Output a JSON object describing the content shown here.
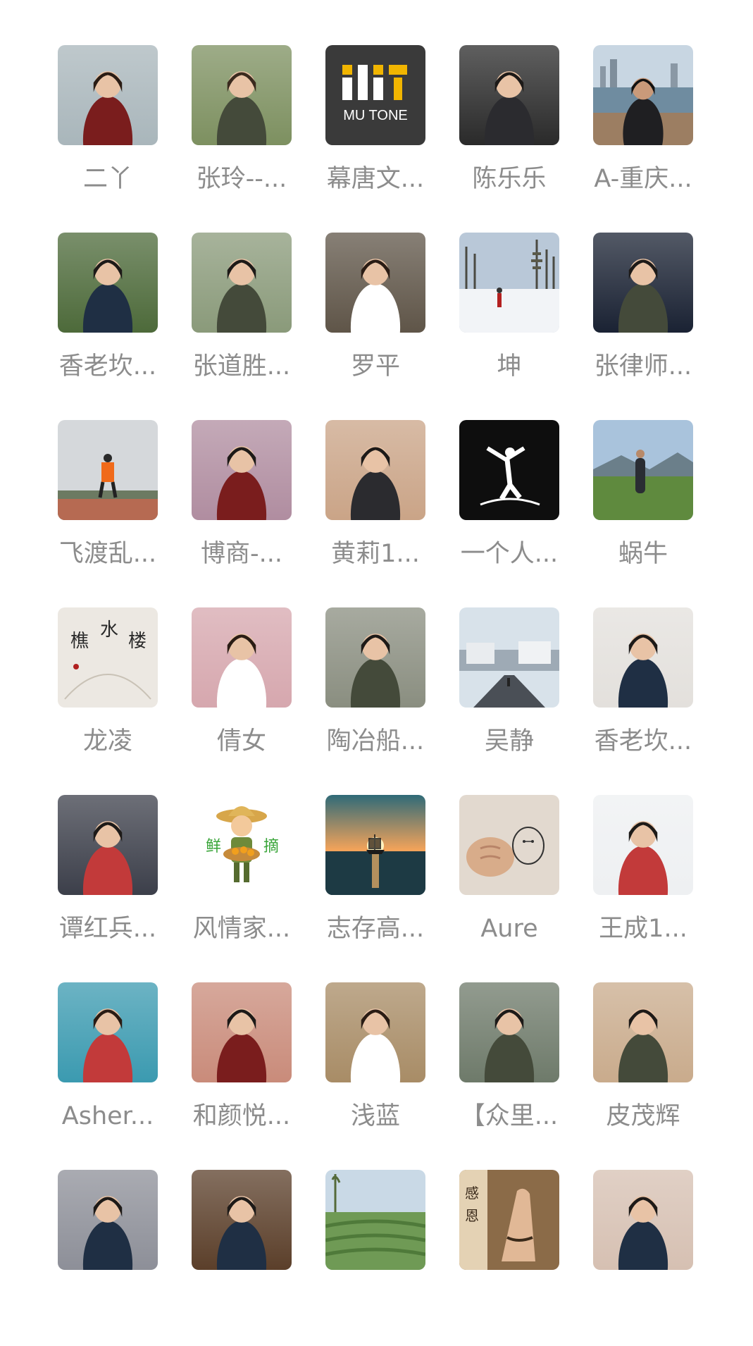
{
  "members": [
    {
      "name": "二丫",
      "avatar": "photo-two-women-seaside",
      "bg": "#a9b6bb"
    },
    {
      "name": "张玲--...",
      "avatar": "photo-woman-garden",
      "bg": "#7d9060"
    },
    {
      "name": "幕唐文...",
      "avatar": "logo-mu-tone",
      "bg": "#3a3a3a",
      "logo_text": "MU TONE"
    },
    {
      "name": "陈乐乐",
      "avatar": "photo-mother-and-child-portrait",
      "bg": "#2a2a2a"
    },
    {
      "name": "A-重庆...",
      "avatar": "photo-man-harbor-city",
      "bg": "#8ea4b3"
    },
    {
      "name": "香老坎...",
      "avatar": "photo-woman-cap-flowers",
      "bg": "#4d6a3a"
    },
    {
      "name": "张道胜...",
      "avatar": "photo-man-glasses-mountains",
      "bg": "#8a9a7a"
    },
    {
      "name": "罗平",
      "avatar": "photo-woman-and-child-bench",
      "bg": "#5f5548"
    },
    {
      "name": "坤",
      "avatar": "photo-snowy-path-trees",
      "bg": "#b9c8d8"
    },
    {
      "name": "张律师...",
      "avatar": "photo-man-suit-dark",
      "bg": "#1a2233"
    },
    {
      "name": "飞渡乱...",
      "avatar": "photo-runner-track",
      "bg": "#c7cacd"
    },
    {
      "name": "博商-...",
      "avatar": "photo-woman-selfie",
      "bg": "#b08da0"
    },
    {
      "name": "黄莉1...",
      "avatar": "photo-woman-playground",
      "bg": "#caa487"
    },
    {
      "name": "一个人...",
      "avatar": "logo-dancer-silhouette",
      "bg": "#0e0e0e"
    },
    {
      "name": "蜗牛",
      "avatar": "photo-man-grassland",
      "bg": "#5c7a52"
    },
    {
      "name": "龙凌",
      "avatar": "photo-calligraphy-fan",
      "bg": "#ece8e2"
    },
    {
      "name": "倩女",
      "avatar": "photo-woman-blossoms",
      "bg": "#d6a7ae"
    },
    {
      "name": "陶冶船...",
      "avatar": "photo-photographer-tripod",
      "bg": "#8a8e80"
    },
    {
      "name": "吴静",
      "avatar": "photo-boardwalk-winter",
      "bg": "#bfc9d2"
    },
    {
      "name": "香老坎...",
      "avatar": "photo-smiling-toddler",
      "bg": "#e3e0dc"
    },
    {
      "name": "谭红兵...",
      "avatar": "photo-boy-drinking",
      "bg": "#3c3f4a"
    },
    {
      "name": "风情家...",
      "avatar": "logo-farmer-cartoon",
      "bg": "#ffffff"
    },
    {
      "name": "志存高...",
      "avatar": "photo-sunset-ship",
      "bg": "#2b5560"
    },
    {
      "name": "Aure",
      "avatar": "photo-fist-baymax-drawing",
      "bg": "#e2d9cf"
    },
    {
      "name": "王成1...",
      "avatar": "photo-doctor-white-coat",
      "bg": "#eef0f2"
    },
    {
      "name": "Asher...",
      "avatar": "photo-man-tropical-beach",
      "bg": "#3b9ab0"
    },
    {
      "name": "和颜悦...",
      "avatar": "photo-woman-pose-red",
      "bg": "#c98b7a"
    },
    {
      "name": "浅蓝",
      "avatar": "photo-woman-dance-studio",
      "bg": "#a88c66"
    },
    {
      "name": "【众里...",
      "avatar": "photo-woman-road",
      "bg": "#6e7a6a"
    },
    {
      "name": "皮茂辉",
      "avatar": "photo-woman-uniform",
      "bg": "#c9ab8c"
    },
    {
      "name": "",
      "avatar": "photo-hoodie-back",
      "bg": "#8d8f98"
    },
    {
      "name": "",
      "avatar": "photo-man-balloon-party",
      "bg": "#5b3f2a"
    },
    {
      "name": "",
      "avatar": "photo-tea-field",
      "bg": "#7f9e6a"
    },
    {
      "name": "",
      "avatar": "photo-praying-hands",
      "bg": "#8b6b48"
    },
    {
      "name": "",
      "avatar": "photo-woman-red-top",
      "bg": "#d6c0b2"
    }
  ]
}
